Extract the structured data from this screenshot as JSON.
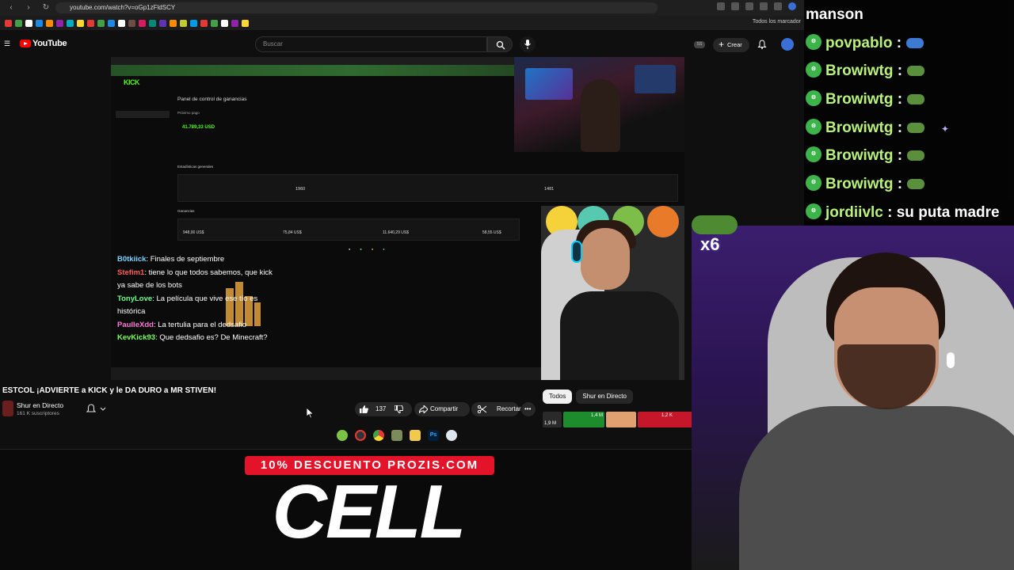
{
  "browser": {
    "url": "youtube.com/watch?v=oGp1zFldSCY",
    "bookmarks_label": "Todos los marcador"
  },
  "youtube": {
    "logo_text": "YouTube",
    "search_placeholder": "Buscar",
    "create_label": "Crear"
  },
  "video": {
    "kick_logo": "KICK",
    "panel_title": "Panel de control de ganancias",
    "next_payment_label": "Próximo pago",
    "next_payment_amount": "41.789,33 USD",
    "general_stats_label": "Estadísticas generales",
    "stat_subscriptions": "1960",
    "stat_interactions": "1481",
    "earnings_label": "Ganancias",
    "earn_1": "948,00 US$",
    "earn_2": "75,84 US$",
    "earn_3": "11.640,29 US$",
    "earn_4": "58,55 US$",
    "overlay_chat": [
      {
        "name": "B0tkiick",
        "color": "#7fd3ff",
        "msg": ": Finales de septiembre"
      },
      {
        "name": "Stefim1",
        "color": "#ff5b5b",
        "msg": ": tiene lo que todos sabemos, que kick ya sabe de los bots"
      },
      {
        "name": "TonyLove",
        "color": "#6bff8a",
        "msg": ": La película que vive ese tío es histórica"
      },
      {
        "name": "PaulleXdd",
        "color": "#ff7ad9",
        "msg": ": La tertulia para el dedsafio"
      },
      {
        "name": "KevKick93",
        "color": "#7dff5a",
        "msg": ": Que dedsafio es? De Minecraft?"
      }
    ]
  },
  "meta": {
    "title": "ESTCOL ¡ADVIERTE a KICK y le DA DURO a MR STIVEN!",
    "channel_name": "Shur en Directo",
    "subscribers": "161 K suscriptores",
    "likes": "137",
    "share_label": "Compartir",
    "clip_label": "Recortar",
    "tab_all": "Todos",
    "tab_channel": "Shur en Directo",
    "thumb_1_views": "1,9 M",
    "thumb_2_views": "1,4 M",
    "thumb_3_views": "1,2 K"
  },
  "stream_chat": [
    {
      "user": "manson",
      "msg": "",
      "badge": false
    },
    {
      "user": "povpablo",
      "msg": " :",
      "badge": true
    },
    {
      "user": "Browiwtg",
      "msg": " :",
      "badge": true
    },
    {
      "user": "Browiwtg",
      "msg": " :",
      "badge": true
    },
    {
      "user": "Browiwtg",
      "msg": " :",
      "badge": true
    },
    {
      "user": "Browiwtg",
      "msg": " :",
      "badge": true
    },
    {
      "user": "Browiwtg",
      "msg": " :",
      "badge": true
    },
    {
      "user": "jordiivlc",
      "msg": " : su puta madre",
      "badge": true
    }
  ],
  "overlay": {
    "multiplier": "x6",
    "promo": "10% DESCUENTO PROZIS.COM",
    "cell_text": "CELL"
  },
  "colors": {
    "chat_user": "#b9f27a",
    "kick_green": "#53fc18",
    "promo_red": "#e3132a"
  }
}
